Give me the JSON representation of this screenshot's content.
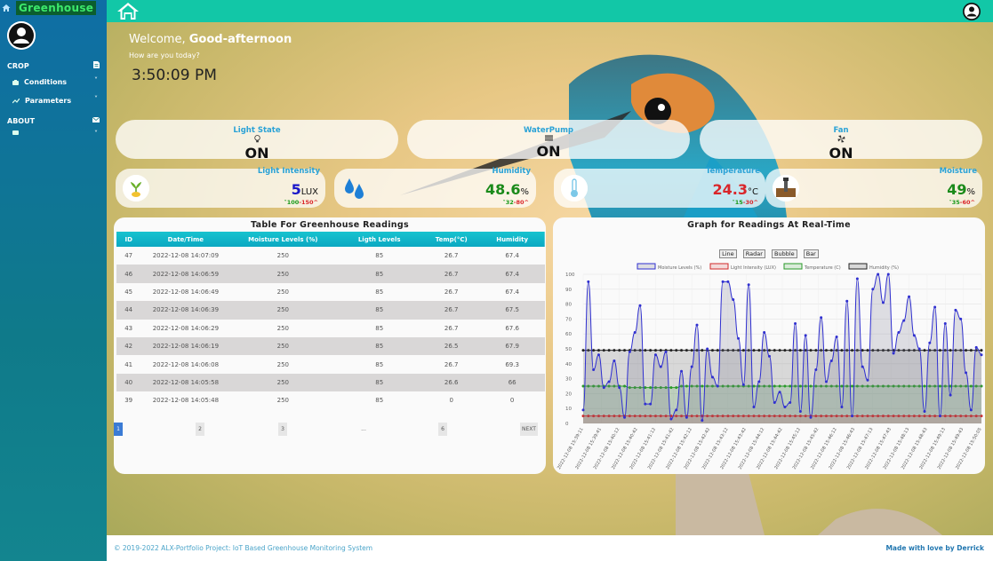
{
  "sidebar": {
    "brand": "Greenhouse",
    "sections": [
      {
        "label": "CROP",
        "items": [
          {
            "label": "Conditions"
          },
          {
            "label": "Parameters"
          }
        ]
      },
      {
        "label": "ABOUT"
      }
    ]
  },
  "welcome": {
    "prefix": "Welcome,",
    "greeting": "Good-afternoon",
    "question": "How are you today?",
    "time": "3:50:09 PM"
  },
  "states": [
    {
      "title": "Light State",
      "value": "ON",
      "icon": "bulb-icon"
    },
    {
      "title": "WaterPump",
      "value": "ON",
      "icon": "pump-icon"
    },
    {
      "title": "Fan",
      "value": "ON",
      "icon": "fan-icon"
    }
  ],
  "sensors": {
    "light": {
      "title": "Light Intensity",
      "value": "5",
      "unit": "LUX",
      "low": "100",
      "high": "150",
      "color": "#1a17c9"
    },
    "humidity": {
      "title": "Humidity",
      "value": "48.6",
      "unit": "%",
      "low": "32",
      "high": "80",
      "color": "#1a8a1a"
    },
    "temperature": {
      "title": "Temperature",
      "value": "24.3",
      "unit": "°C",
      "low": "15",
      "high": "30",
      "color": "#d9262a"
    },
    "moisture": {
      "title": "Moisture",
      "value": "49",
      "unit": "%",
      "low": "35",
      "high": "60",
      "color": "#1a8a1a"
    }
  },
  "table": {
    "title": "Table For Greenhouse Readings",
    "headers": [
      "ID",
      "Date/Time",
      "Moisture Levels (%)",
      "Ligth Levels",
      "Temp(°C)",
      "Humidity"
    ],
    "rows": [
      [
        "47",
        "2022-12-08 14:07:09",
        "250",
        "85",
        "26.7",
        "67.4"
      ],
      [
        "46",
        "2022-12-08 14:06:59",
        "250",
        "85",
        "26.7",
        "67.4"
      ],
      [
        "45",
        "2022-12-08 14:06:49",
        "250",
        "85",
        "26.7",
        "67.4"
      ],
      [
        "44",
        "2022-12-08 14:06:39",
        "250",
        "85",
        "26.7",
        "67.5"
      ],
      [
        "43",
        "2022-12-08 14:06:29",
        "250",
        "85",
        "26.7",
        "67.6"
      ],
      [
        "42",
        "2022-12-08 14:06:19",
        "250",
        "85",
        "26.5",
        "67.9"
      ],
      [
        "41",
        "2022-12-08 14:06:08",
        "250",
        "85",
        "26.7",
        "69.3"
      ],
      [
        "40",
        "2022-12-08 14:05:58",
        "250",
        "85",
        "26.6",
        "66"
      ],
      [
        "39",
        "2022-12-08 14:05:48",
        "250",
        "85",
        "0",
        "0"
      ]
    ],
    "pages": [
      "1",
      "2",
      "3",
      "...",
      "6",
      "NEXT"
    ]
  },
  "graph": {
    "title": "Graph for Readings At Real-Time",
    "buttons": [
      "Line",
      "Radar",
      "Bubble",
      "Bar"
    ]
  },
  "chart_data": {
    "type": "line",
    "title": "Graph for Readings At Real-Time",
    "ylim": [
      0,
      100
    ],
    "yticks": [
      0,
      10,
      20,
      30,
      40,
      50,
      60,
      70,
      80,
      90,
      100
    ],
    "xticks": [
      "2022-12-08 15:39:11",
      "2022-12-08 15:39:41",
      "2022-12-08 15:40:12",
      "2022-12-08 15:40:42",
      "2022-12-08 15:41:12",
      "2022-12-08 15:41:42",
      "2022-12-08 15:42:12",
      "2022-12-08 15:42:42",
      "2022-12-08 15:43:12",
      "2022-12-08 15:43:42",
      "2022-12-08 15:44:12",
      "2022-12-08 15:44:42",
      "2022-12-08 15:45:12",
      "2022-12-08 15:45:42",
      "2022-12-08 15:46:12",
      "2022-12-08 15:46:43",
      "2022-12-08 15:47:13",
      "2022-12-08 15:47:43",
      "2022-12-08 15:48:13",
      "2022-12-08 15:48:43",
      "2022-12-08 15:49:13",
      "2022-12-08 15:49:43",
      "2022-12-08 15:50:05"
    ],
    "series": [
      {
        "name": "Moisture Levels (%)",
        "color": "#3030d0",
        "fill": "rgba(120,120,140,0.22)",
        "values": [
          9,
          95,
          36,
          46,
          24,
          28,
          42,
          24,
          4,
          48,
          61,
          79,
          13,
          13,
          46,
          38,
          48,
          3,
          9,
          35,
          4,
          38,
          66,
          2,
          50,
          31,
          25,
          95,
          95,
          83,
          57,
          26,
          93,
          11,
          28,
          61,
          45,
          14,
          21,
          11,
          14,
          67,
          8,
          59,
          4,
          36,
          71,
          28,
          42,
          58,
          11,
          82,
          5,
          97,
          38,
          29,
          90,
          100,
          81,
          100,
          47,
          61,
          69,
          85,
          59,
          50,
          8,
          54,
          78,
          5,
          67,
          19,
          76,
          70,
          34,
          9,
          51,
          46
        ]
      },
      {
        "name": "Light Intensity (LUX)",
        "color": "#d02a2a",
        "fill": "rgba(208,42,42,0.15)",
        "values": [
          5,
          5,
          5,
          5,
          5,
          5,
          5,
          5,
          5,
          5,
          5,
          5,
          5,
          5,
          5,
          5,
          5,
          5,
          5,
          5,
          5,
          5,
          5,
          5,
          5,
          5,
          5,
          5,
          5,
          5,
          5,
          5,
          5,
          5,
          5,
          5,
          5,
          5,
          5,
          5,
          5,
          5,
          5,
          5,
          5,
          5,
          5,
          5,
          5,
          5,
          5,
          5,
          5,
          5,
          5,
          5,
          5,
          5,
          5,
          5,
          5,
          5,
          5,
          5,
          5,
          5,
          5,
          5,
          5,
          5,
          5,
          5,
          5,
          5,
          5,
          5,
          5,
          5
        ]
      },
      {
        "name": "Temperature (C)",
        "color": "#2a9a2a",
        "fill": "rgba(42,154,42,0.15)",
        "values": [
          25,
          25,
          25,
          25,
          25,
          25,
          25,
          25,
          25,
          24,
          24,
          24,
          24,
          24,
          24,
          24,
          24,
          24,
          24,
          25,
          25,
          25,
          25,
          25,
          25,
          25,
          25,
          25,
          25,
          25,
          25,
          25,
          25,
          25,
          25,
          25,
          25,
          25,
          25,
          25,
          25,
          25,
          25,
          25,
          25,
          25,
          25,
          25,
          25,
          25,
          25,
          25,
          25,
          25,
          25,
          25,
          25,
          25,
          25,
          25,
          25,
          25,
          25,
          25,
          25,
          25,
          25,
          25,
          25,
          25,
          25,
          25,
          25,
          25,
          25,
          25,
          25,
          25
        ]
      },
      {
        "name": "Humidity (%)",
        "color": "#222222",
        "fill": "rgba(30,30,30,0.15)",
        "values": [
          49,
          49,
          49,
          49,
          49,
          49,
          49,
          49,
          49,
          49,
          49,
          49,
          49,
          49,
          49,
          49,
          49,
          49,
          49,
          49,
          49,
          49,
          49,
          49,
          49,
          49,
          49,
          49,
          49,
          49,
          49,
          49,
          49,
          49,
          49,
          49,
          49,
          49,
          49,
          49,
          49,
          49,
          49,
          49,
          49,
          49,
          49,
          49,
          49,
          49,
          49,
          49,
          49,
          49,
          49,
          49,
          49,
          49,
          49,
          49,
          49,
          49,
          49,
          49,
          49,
          49,
          49,
          49,
          49,
          49,
          49,
          49,
          49,
          49,
          49,
          49,
          49,
          49
        ]
      }
    ]
  },
  "footer": {
    "copyright": "© 2019-2022 ALX-Portfolio Project: IoT Based Greenhouse Monitoring System",
    "credit": "Made with love by Derrick"
  }
}
